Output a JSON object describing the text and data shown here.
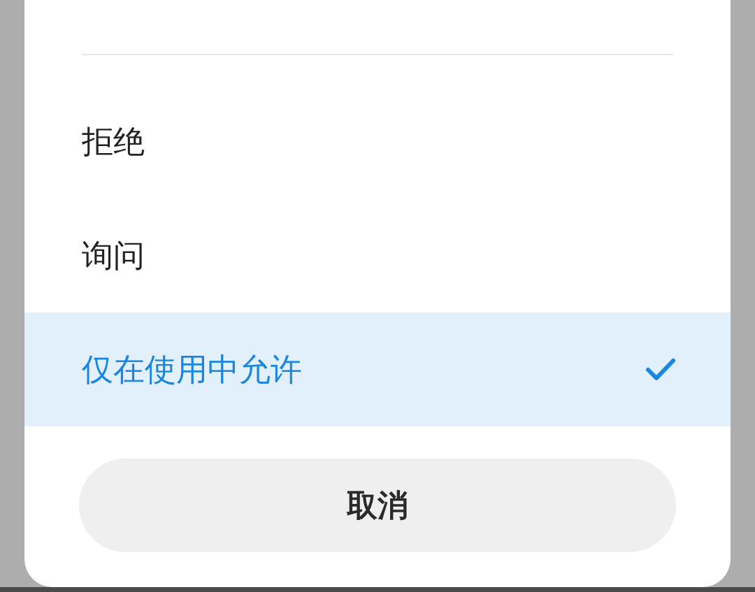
{
  "options": [
    {
      "label": "拒绝",
      "selected": false
    },
    {
      "label": "询问",
      "selected": false
    },
    {
      "label": "仅在使用中允许",
      "selected": true
    }
  ],
  "cancel_button": "取消"
}
